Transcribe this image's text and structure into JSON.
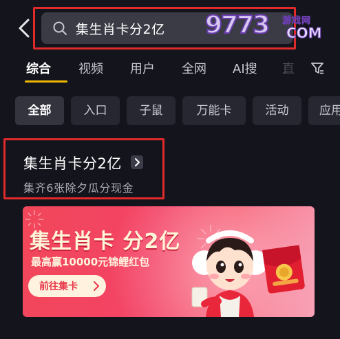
{
  "header": {
    "back_icon": "chevron-left-icon",
    "search_icon": "search-icon",
    "search_value": "集生肖卡分2亿"
  },
  "watermark": {
    "number": "9773",
    "text_cn": "游戏网",
    "text_en": "COM"
  },
  "tabs": [
    {
      "label": "综合",
      "active": true
    },
    {
      "label": "视频",
      "active": false
    },
    {
      "label": "用户",
      "active": false
    },
    {
      "label": "全网",
      "active": false
    },
    {
      "label": "AI搜",
      "active": false
    },
    {
      "label": "直",
      "active": false
    }
  ],
  "filter_icon": "filter-icon",
  "chips": [
    {
      "label": "全部",
      "active": true
    },
    {
      "label": "入口",
      "active": false
    },
    {
      "label": "子鼠",
      "active": false
    },
    {
      "label": "万能卡",
      "active": false
    },
    {
      "label": "活动",
      "active": false
    },
    {
      "label": "应用",
      "active": false
    }
  ],
  "result": {
    "title": "集生肖卡分2亿",
    "subtitle": "集齐6张除夕瓜分现金"
  },
  "banner": {
    "title": "集生肖卡 分2亿",
    "subtitle": "最高赢10000元锦鲤红包",
    "button_label": "前往集卡"
  },
  "colors": {
    "background": "#14151c",
    "search_bg": "#3a3b45",
    "tab_underline": "#f0b800",
    "highlight_box": "#e12a2a",
    "banner_red": "#f2465a"
  }
}
